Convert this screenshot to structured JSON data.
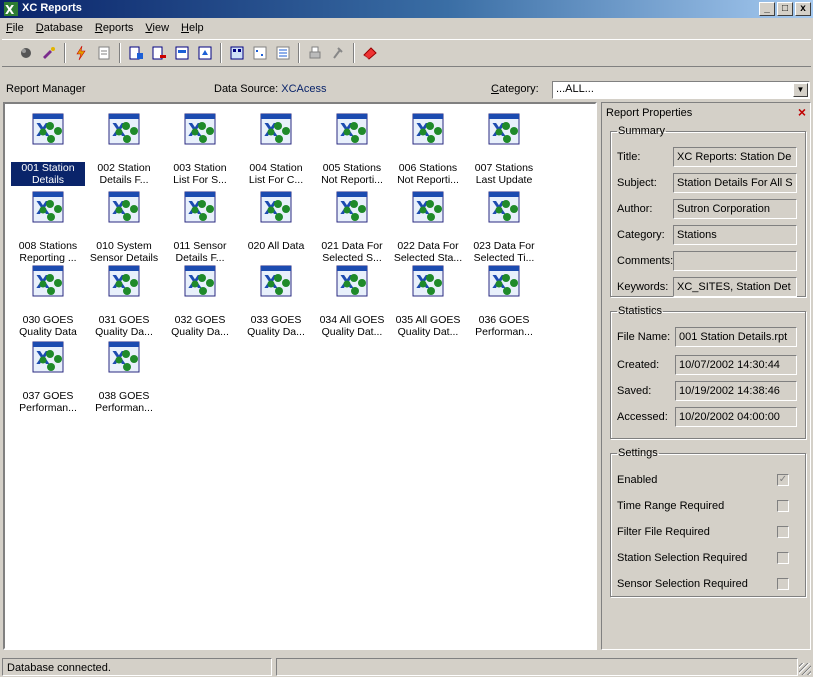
{
  "window": {
    "title": "XC Reports",
    "min_label": "_",
    "max_label": "□",
    "close_label": "x"
  },
  "menu": [
    "File",
    "Database",
    "Reports",
    "View",
    "Help"
  ],
  "toolbar_icons": [
    "open-icon",
    "wizard-icon",
    "sep",
    "lightning-icon",
    "document-icon",
    "sep",
    "insert-report-icon",
    "remove-report-icon",
    "print-preview-icon",
    "export-icon",
    "sep",
    "large-icons-icon",
    "small-icons-icon",
    "details-view-icon",
    "sep",
    "print-icon",
    "tools-icon",
    "sep",
    "eraser-icon"
  ],
  "infobar": {
    "report_manager": "Report Manager",
    "data_source_label": "Data Source:",
    "data_source_value": "XCAcess",
    "category_label": "Category:",
    "category_value": "...ALL..."
  },
  "reports": [
    {
      "label": "001 Station Details",
      "selected": true
    },
    {
      "label": "002 Station Details F..."
    },
    {
      "label": "003 Station List For S..."
    },
    {
      "label": "004 Station List For C..."
    },
    {
      "label": "005 Stations Not Reporti..."
    },
    {
      "label": "006 Stations Not Reporti..."
    },
    {
      "label": "007 Stations Last Update"
    },
    {
      "label": "008 Stations Reporting ..."
    },
    {
      "label": "010 System Sensor Details"
    },
    {
      "label": "011 Sensor Details F..."
    },
    {
      "label": "020 All Data"
    },
    {
      "label": "021 Data For Selected S..."
    },
    {
      "label": "022 Data For Selected Sta..."
    },
    {
      "label": "023 Data For Selected Ti..."
    },
    {
      "label": "030 GOES Quality Data"
    },
    {
      "label": "031 GOES Quality Da..."
    },
    {
      "label": "032 GOES Quality Da..."
    },
    {
      "label": "033 GOES Quality Da..."
    },
    {
      "label": "034 All GOES Quality Dat..."
    },
    {
      "label": "035 All GOES Quality Dat..."
    },
    {
      "label": "036 GOES Performan..."
    },
    {
      "label": "037 GOES Performan..."
    },
    {
      "label": "038 GOES Performan..."
    }
  ],
  "properties": {
    "header": "Report Properties",
    "close": "×",
    "summary": {
      "legend": "Summary",
      "title_label": "Title:",
      "title_value": "XC Reports: Station De",
      "subject_label": "Subject:",
      "subject_value": "Station Details For All S",
      "author_label": "Author:",
      "author_value": "Sutron Corporation",
      "category_label": "Category:",
      "category_value": "Stations",
      "comments_label": "Comments:",
      "comments_value": "",
      "keywords_label": "Keywords:",
      "keywords_value": "XC_SITES, Station Det"
    },
    "statistics": {
      "legend": "Statistics",
      "filename_label": "File Name:",
      "filename_value": "001 Station Details.rpt",
      "created_label": "Created:",
      "created_value": "10/07/2002 14:30:44",
      "saved_label": "Saved:",
      "saved_value": "10/19/2002 14:38:46",
      "accessed_label": "Accessed:",
      "accessed_value": "10/20/2002 04:00:00"
    },
    "settings": {
      "legend": "Settings",
      "items": [
        {
          "label": "Enabled",
          "checked": true
        },
        {
          "label": "Time Range Required",
          "checked": false
        },
        {
          "label": "Filter File Required",
          "checked": false
        },
        {
          "label": "Station Selection Required",
          "checked": false
        },
        {
          "label": "Sensor Selection Required",
          "checked": false
        }
      ]
    }
  },
  "status": {
    "text": "Database connected."
  }
}
